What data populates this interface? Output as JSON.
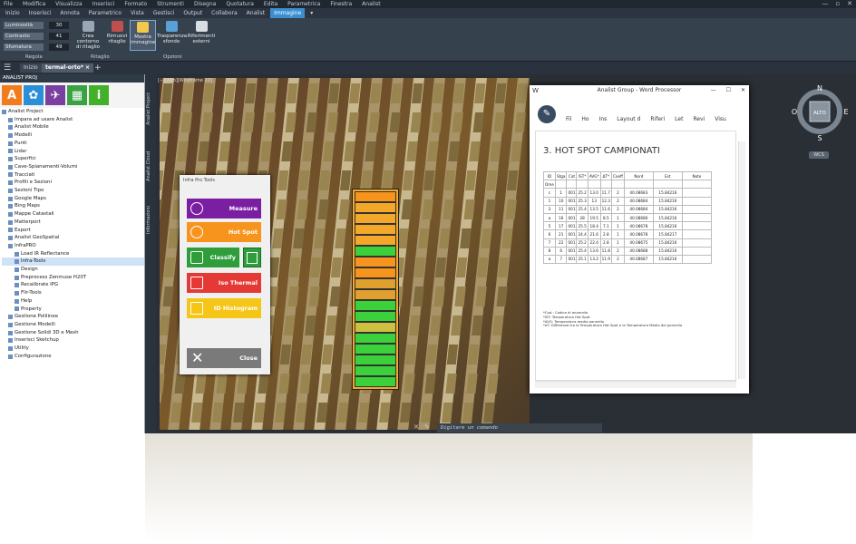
{
  "menubar": {
    "items": [
      "File",
      "Modifica",
      "Visualizza",
      "Inserisci",
      "Formato",
      "Strumenti",
      "Disegna",
      "Quotatura",
      "Edita",
      "Parametrica",
      "Finestra",
      "Analist"
    ],
    "window_controls": [
      "—",
      "▫",
      "✕"
    ]
  },
  "ribbon_tabs": [
    "Inizio",
    "Inserisci",
    "Annota",
    "Parametrico",
    "Vista",
    "Gestisci",
    "Output",
    "Collabora",
    "Analist",
    "Immagine",
    "▾"
  ],
  "active_ribbon_tab": "Immagine",
  "ribbon": {
    "sliders": [
      {
        "label": "Luminosità",
        "value": "30"
      },
      {
        "label": "Contrasto",
        "value": "41"
      },
      {
        "label": "Sfumatura",
        "value": "49"
      }
    ],
    "buttons": [
      {
        "label1": "Crea contorno",
        "label2": "di ritaglio"
      },
      {
        "label1": "Rimuovi",
        "label2": "ritaglio"
      },
      {
        "label1": "Mostra",
        "label2": "immagine"
      },
      {
        "label1": "Trasparenza",
        "label2": "sfondo"
      },
      {
        "label1": "Riferimenti",
        "label2": "esterni"
      }
    ],
    "groups": [
      "Regola",
      "Ritaglio",
      "Opzioni"
    ]
  },
  "doc_tabs": {
    "home": "Inizio",
    "active": "termal-orto*",
    "close": "×",
    "add": "+",
    "menu": "☰"
  },
  "panel": {
    "title": "ANALIST PROJ",
    "icons": [
      {
        "glyph": "A",
        "color": "#f07c1e"
      },
      {
        "glyph": "✿",
        "color": "#2a8fd6"
      },
      {
        "glyph": "✈",
        "color": "#7b3fa0"
      },
      {
        "glyph": "▦",
        "color": "#3aa244"
      },
      {
        "glyph": "i",
        "color": "#43b02a"
      }
    ],
    "tree": [
      {
        "label": "Analist Project",
        "indent": 0
      },
      {
        "label": "Impara ad usare Analist",
        "indent": 1
      },
      {
        "label": "Analist Mobile",
        "indent": 1
      },
      {
        "label": "Modelli",
        "indent": 1
      },
      {
        "label": "Punti",
        "indent": 1
      },
      {
        "label": "Lidar",
        "indent": 1
      },
      {
        "label": "Superfici",
        "indent": 1
      },
      {
        "label": "Cave-Spianamenti-Volumi",
        "indent": 1
      },
      {
        "label": "Tracciati",
        "indent": 1
      },
      {
        "label": "Profili e Sezioni",
        "indent": 1
      },
      {
        "label": "Sezioni Tipo",
        "indent": 1
      },
      {
        "label": "Google Maps",
        "indent": 1
      },
      {
        "label": "Bing Maps",
        "indent": 1
      },
      {
        "label": "Mappe Catastali",
        "indent": 1
      },
      {
        "label": "Matterport",
        "indent": 1
      },
      {
        "label": "Export",
        "indent": 1
      },
      {
        "label": "Analist GeoSpatial",
        "indent": 1
      },
      {
        "label": "InfraPRO",
        "indent": 1
      },
      {
        "label": "Load IR Reflectance",
        "indent": 2
      },
      {
        "label": "Infra-Tools",
        "indent": 2,
        "selected": true
      },
      {
        "label": "Design",
        "indent": 2
      },
      {
        "label": "Preprocess Zenmuse H20T",
        "indent": 2
      },
      {
        "label": "Recalibrate IPG",
        "indent": 2
      },
      {
        "label": "Flir-Tools",
        "indent": 2
      },
      {
        "label": "Help",
        "indent": 2
      },
      {
        "label": "Property",
        "indent": 2
      },
      {
        "label": "Gestione Polilinee",
        "indent": 1
      },
      {
        "label": "Gestione Modelli",
        "indent": 1
      },
      {
        "label": "Gestione Solidi 3D e Mesh",
        "indent": 1
      },
      {
        "label": "Inserisci Sketchup",
        "indent": 1
      },
      {
        "label": "Utility",
        "indent": 1
      },
      {
        "label": "Configurazione",
        "indent": 1
      }
    ]
  },
  "vertical_tabs": [
    "Analist Project",
    "Analist Cloud",
    "Informazioni"
  ],
  "viewport_label": "[−][Alto][Wireframe 2D]",
  "tools_window": {
    "title": "Infra Pro Tools",
    "buttons": [
      {
        "label": "Measure",
        "color": "#7b1fa2"
      },
      {
        "label": "Hot Spot",
        "color": "#f7941d"
      },
      {
        "label": "Classify",
        "color": "#2e9d3a"
      },
      {
        "label": "Iso Thermal",
        "color": "#e53935"
      },
      {
        "label": "ID Histogram",
        "color": "#f5c518"
      }
    ],
    "close_label": "Close"
  },
  "word": {
    "title": "Analist Group - Word Processor",
    "logo": "W",
    "controls": [
      "—",
      "☐",
      "✕"
    ],
    "menu": [
      "Fil",
      "Ho",
      "Ins",
      "Layout d",
      "Riferi",
      "Let",
      "Revi",
      "Visu"
    ],
    "heading": "3. HOT SPOT CAMPIONATI",
    "table_header": [
      "ID",
      "Stga",
      "Cat",
      "IST*",
      "AVG*",
      "ΔT*",
      "Coeff",
      "Nord",
      "Est",
      "Note"
    ],
    "table_sub": "Ome",
    "table_rows": [
      [
        "c",
        "1",
        "001",
        "25.2",
        "13.0",
        "11.7",
        "2",
        "40.08683",
        "15.84216",
        ""
      ],
      [
        "1",
        "10",
        "001",
        "25.3",
        "13",
        "12.3",
        "2",
        "40.08684",
        "15.84216",
        ""
      ],
      [
        "3",
        "11",
        "001",
        "25.4",
        "13.5",
        "11.6",
        "2",
        "40.08684",
        "15.84216",
        ""
      ],
      [
        "a",
        "16",
        "001",
        "28",
        "19.5",
        "8.5",
        "1",
        "40.08686",
        "15.84216",
        ""
      ],
      [
        "5",
        "17",
        "001",
        "25.5",
        "18.4",
        "7.1",
        "1",
        "40.08678",
        "15.84216",
        ""
      ],
      [
        "6",
        "21",
        "001",
        "24.4",
        "21.6",
        "2.8",
        "1",
        "40.08678",
        "15.84217",
        ""
      ],
      [
        "7",
        "22",
        "001",
        "25.2",
        "22.4",
        "2.8",
        "1",
        "40.08675",
        "15.84216",
        ""
      ],
      [
        "8",
        "6",
        "001",
        "25.4",
        "13.6",
        "11.8",
        "2",
        "40.08688",
        "15.84216",
        ""
      ],
      [
        "a",
        "7",
        "001",
        "25.1",
        "13.2",
        "11.9",
        "2",
        "40.08687",
        "15.84216",
        ""
      ]
    ],
    "notes": [
      "*Cod.: Codice di anomalia",
      "*IST: Temperatura Hot Spot",
      "*AVG: Temperatura media pannello",
      "*ΔT: Differenza tra la Temperatura Hot Spot e la Temperatura Media del pannello"
    ]
  },
  "compass": {
    "N": "N",
    "S": "S",
    "E": "E",
    "W": "O",
    "center": "ALTO",
    "wcs": "WCS"
  },
  "command_line": {
    "placeholder": "Digitare un comando",
    "close": "✕",
    "settings": "✎"
  }
}
